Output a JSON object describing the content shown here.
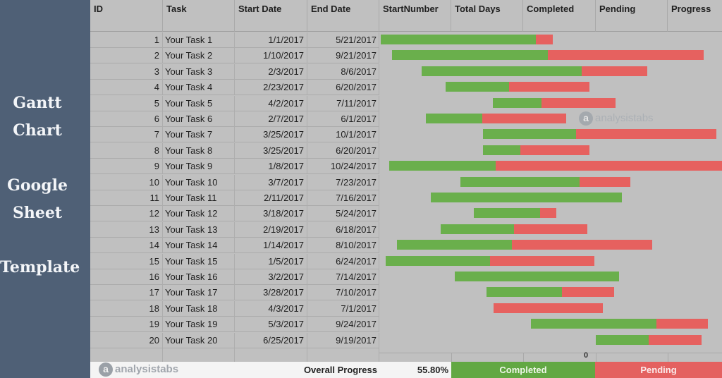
{
  "sidebar": {
    "lines": [
      "Gantt",
      "Chart",
      "Google",
      "Sheet",
      "Template"
    ]
  },
  "columns": {
    "id": "ID",
    "task": "Task",
    "start": "Start Date",
    "end": "End Date",
    "start_number": "StartNumber",
    "total_days": "Total Days",
    "completed": "Completed",
    "pending": "Pending",
    "progress": "Progress"
  },
  "watermark": {
    "icon": "a",
    "text": "analysistabs"
  },
  "footer": {
    "logo_icon": "a",
    "logo_text": "analysistabs",
    "overall_label": "Overall Progress",
    "overall_value": "55.80%",
    "legend_completed": "Completed",
    "legend_pending": "Pending"
  },
  "colors": {
    "completed": "#6aaf4c",
    "pending": "#e6615f",
    "sidebar": "#4f6076"
  },
  "chart_data": {
    "type": "bar",
    "subtype": "gantt-stacked-horizontal",
    "title": "Gantt Chart",
    "x_axis_start": "1/1/2017",
    "x_axis_tick_label": "0",
    "legend": [
      "Completed",
      "Pending"
    ],
    "legend_placement": "bottom",
    "tasks": [
      {
        "id": "1",
        "name": "Your Task 1",
        "start": "1/1/2017",
        "end": "5/21/2017",
        "progress": 0.9
      },
      {
        "id": "2",
        "name": "Your Task 2",
        "start": "1/10/2017",
        "end": "9/21/2017",
        "progress": 0.5
      },
      {
        "id": "3",
        "name": "Your Task 3",
        "start": "2/3/2017",
        "end": "8/6/2017",
        "progress": 0.71
      },
      {
        "id": "4",
        "name": "Your Task 4",
        "start": "2/23/2017",
        "end": "6/20/2017",
        "progress": 0.44
      },
      {
        "id": "5",
        "name": "Your Task 5",
        "start": "4/2/2017",
        "end": "7/11/2017",
        "progress": 0.4
      },
      {
        "id": "6",
        "name": "Your Task 6",
        "start": "2/7/2017",
        "end": "6/1/2017",
        "progress": 0.4
      },
      {
        "id": "7",
        "name": "Your Task 7",
        "start": "3/25/2017",
        "end": "10/1/2017",
        "progress": 0.4
      },
      {
        "id": "8",
        "name": "Your Task 8",
        "start": "3/25/2017",
        "end": "6/20/2017",
        "progress": 0.35
      },
      {
        "id": "9",
        "name": "Your Task 9",
        "start": "1/8/2017",
        "end": "10/24/2017",
        "progress": 0.3
      },
      {
        "id": "10",
        "name": "Your Task 10",
        "start": "3/7/2017",
        "end": "7/23/2017",
        "progress": 0.7
      },
      {
        "id": "11",
        "name": "Your Task 11",
        "start": "2/11/2017",
        "end": "7/16/2017",
        "progress": 1.0
      },
      {
        "id": "12",
        "name": "Your Task 12",
        "start": "3/18/2017",
        "end": "5/24/2017",
        "progress": 0.8
      },
      {
        "id": "13",
        "name": "Your Task 13",
        "start": "2/19/2017",
        "end": "6/18/2017",
        "progress": 0.5
      },
      {
        "id": "14",
        "name": "Your Task 14",
        "start": "1/14/2017",
        "end": "8/10/2017",
        "progress": 0.45
      },
      {
        "id": "15",
        "name": "Your Task 15",
        "start": "1/5/2017",
        "end": "6/24/2017",
        "progress": 0.5
      },
      {
        "id": "16",
        "name": "Your Task 16",
        "start": "3/2/2017",
        "end": "7/14/2017",
        "progress": 1.0
      },
      {
        "id": "17",
        "name": "Your Task 17",
        "start": "3/28/2017",
        "end": "7/10/2017",
        "progress": 0.59
      },
      {
        "id": "18",
        "name": "Your Task 18",
        "start": "4/3/2017",
        "end": "7/1/2017",
        "progress": 0.0
      },
      {
        "id": "19",
        "name": "Your Task 19",
        "start": "5/3/2017",
        "end": "9/24/2017",
        "progress": 0.71
      },
      {
        "id": "20",
        "name": "Your Task 20",
        "start": "6/25/2017",
        "end": "9/19/2017",
        "progress": 0.5
      }
    ]
  }
}
